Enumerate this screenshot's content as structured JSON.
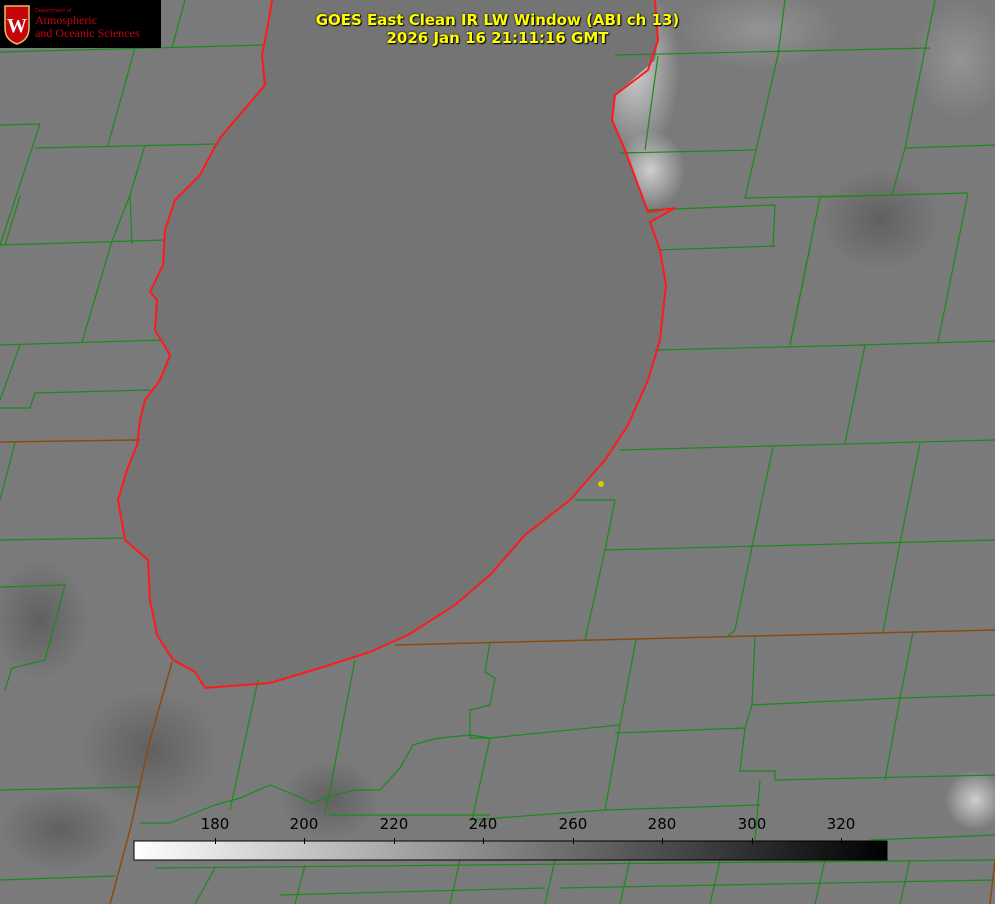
{
  "title": {
    "line1": "GOES East Clean IR LW Window (ABI ch 13)",
    "line2": "2026 Jan 16 21:11:16 GMT"
  },
  "logo": {
    "dept": "Department of",
    "line1": "Atmospheric",
    "line2": "and Oceanic Sciences",
    "crest_letter": "W"
  },
  "colorbar": {
    "ticks": [
      "180",
      "200",
      "220",
      "240",
      "260",
      "280",
      "300",
      "320"
    ],
    "gradient_start": "#ffffff",
    "gradient_end": "#000000"
  },
  "colors": {
    "background_gray": "#7a7a7a",
    "lake_gray": "#747474",
    "county_lines": "#1a8a1a",
    "state_lines": "#8a4a10",
    "lake_outline": "#ff1a1a",
    "title_text": "#ffff00",
    "logo_red": "#c5050c",
    "marker": "#e0c800"
  },
  "icons": {
    "crest": "uw-crest-icon",
    "marker": "station-dot-icon"
  }
}
